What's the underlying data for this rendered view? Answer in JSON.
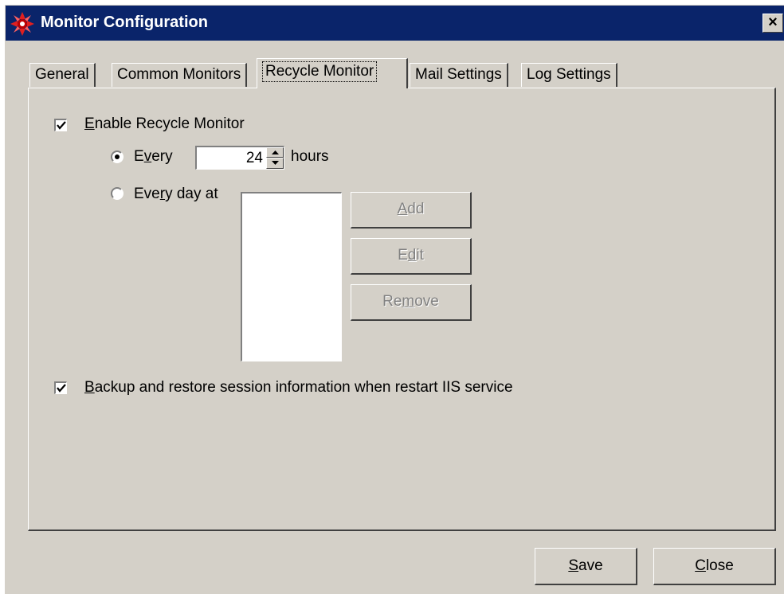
{
  "window": {
    "title": "Monitor Configuration",
    "close_label": "×"
  },
  "tabs": [
    {
      "label": "General"
    },
    {
      "label": "Common Monitors"
    },
    {
      "label": "Recycle Monitor"
    },
    {
      "label": "Mail Settings"
    },
    {
      "label": "Log Settings"
    }
  ],
  "recycle": {
    "enable_label_accel": "E",
    "enable_label_rest": "nable Recycle Monitor",
    "enable_checked": true,
    "every_label_pre": "E",
    "every_label_accel": "v",
    "every_label_post": "ery",
    "every_selected": true,
    "every_value": "24",
    "hours_label": "hours",
    "everyday_label_pre": "Eve",
    "everyday_label_accel": "r",
    "everyday_label_post": "y day at",
    "everyday_selected": false,
    "add_accel": "A",
    "add_rest": "dd",
    "edit_pre": "E",
    "edit_accel": "d",
    "edit_post": "it",
    "remove_pre": "Re",
    "remove_accel": "m",
    "remove_post": "ove",
    "backup_accel": "B",
    "backup_rest": "ackup and restore session information when restart IIS service",
    "backup_checked": true
  },
  "footer": {
    "save_accel": "S",
    "save_rest": "ave",
    "close_accel": "C",
    "close_rest": "lose"
  },
  "icons": {
    "app_icon": "app-logo-icon",
    "check": "checkmark-icon"
  },
  "colors": {
    "titlebar": "#0a246a",
    "face": "#d4d0c8",
    "disabled_text": "#808080"
  }
}
